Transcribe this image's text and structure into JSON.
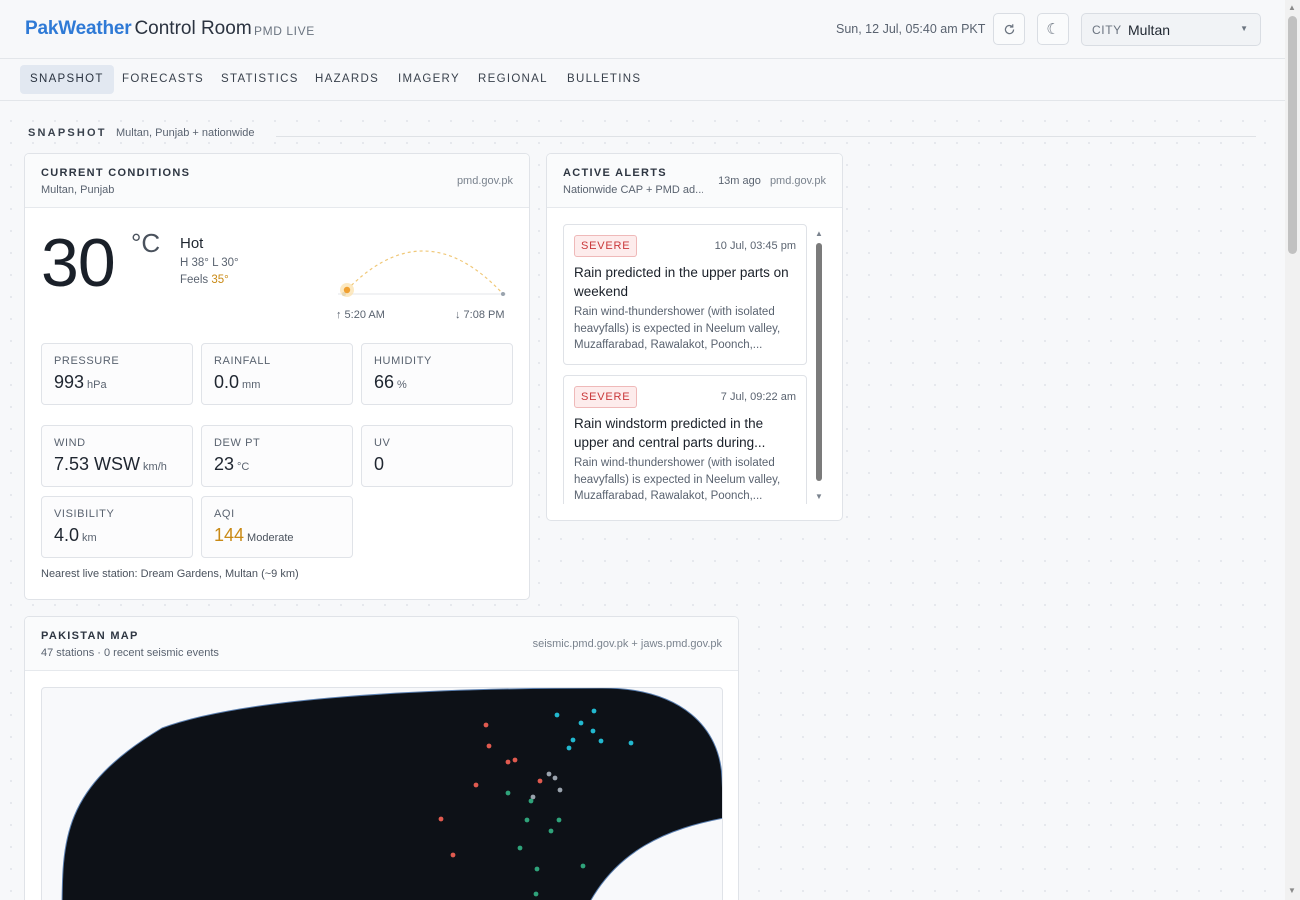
{
  "header": {
    "brand_primary": "PakWeather",
    "brand_secondary": "Control Room",
    "live_tag": "PMD LIVE",
    "datetime": "Sun, 12 Jul, 05:40 am PKT",
    "refresh_icon": "refresh-icon",
    "theme_icon": "moon-icon",
    "city_label": "CITY",
    "city_value": "Multan"
  },
  "nav": {
    "tabs": [
      {
        "label": "SNAPSHOT",
        "active": true
      },
      {
        "label": "FORECASTS",
        "active": false
      },
      {
        "label": "STATISTICS",
        "active": false
      },
      {
        "label": "HAZARDS",
        "active": false
      },
      {
        "label": "IMAGERY",
        "active": false
      },
      {
        "label": "REGIONAL",
        "active": false
      },
      {
        "label": "BULLETINS",
        "active": false
      }
    ]
  },
  "section": {
    "title": "SNAPSHOT",
    "subtitle": "Multan, Punjab + nationwide"
  },
  "current": {
    "title": "CURRENT CONDITIONS",
    "location": "Multan, Punjab",
    "source": "pmd.gov.pk",
    "temp": "30",
    "temp_unit": "°C",
    "condition": "Hot",
    "high_low": "H 38° L 30°",
    "feels_label": "Feels",
    "feels_value": "35°",
    "sunrise": "↑ 5:20 AM",
    "sunset": "↓ 7:08 PM",
    "stats": {
      "pressure": {
        "label": "PRESSURE",
        "value": "993",
        "unit": "hPa"
      },
      "rainfall": {
        "label": "RAINFALL",
        "value": "0.0",
        "unit": "mm"
      },
      "humidity": {
        "label": "HUMIDITY",
        "value": "66",
        "unit": "%"
      },
      "wind": {
        "label": "WIND",
        "value": "7.53 WSW",
        "unit": "km/h"
      },
      "dewpt": {
        "label": "DEW PT",
        "value": "23",
        "unit": "°C"
      },
      "uv": {
        "label": "UV",
        "value": "0",
        "unit": ""
      },
      "visibility": {
        "label": "VISIBILITY",
        "value": "4.0",
        "unit": "km"
      },
      "aqi": {
        "label": "AQI",
        "value": "144",
        "unit": "Moderate"
      }
    },
    "station_note": "Nearest live station: Dream Gardens, Multan (~9 km)"
  },
  "alerts": {
    "title": "ACTIVE ALERTS",
    "subtitle": "Nationwide CAP + PMD ad...",
    "updated": "13m ago",
    "source": "pmd.gov.pk",
    "items": [
      {
        "severity": "SEVERE",
        "time": "10 Jul, 03:45 pm",
        "title": "Rain predicted in the upper parts on weekend",
        "body": "Rain wind-thundershower (with isolated heavyfalls) is expected in Neelum valley, Muzaffarabad, Rawalakot, Poonch,..."
      },
      {
        "severity": "SEVERE",
        "time": "7 Jul, 09:22 am",
        "title": "Rain windstorm predicted in the upper and central parts during...",
        "body": "Rain wind-thundershower (with isolated heavyfalls) is expected in Neelum valley, Muzaffarabad, Rawalakot, Poonch,..."
      }
    ]
  },
  "map": {
    "title": "PAKISTAN MAP",
    "subtitle": "47 stations · 0 recent seismic events",
    "source": "seismic.pmd.gov.pk + jaws.pmd.gov.pk",
    "colors": {
      "land": "#0d1117",
      "red": "#e05a4f",
      "cyan": "#22b8cf",
      "green": "#2fa37a",
      "gray": "#9aa3ad"
    }
  },
  "colors": {
    "brand": "#2f7ad6",
    "severe_text": "#c9383a",
    "severe_bg": "#fdecec",
    "amber": "#c98a16"
  }
}
